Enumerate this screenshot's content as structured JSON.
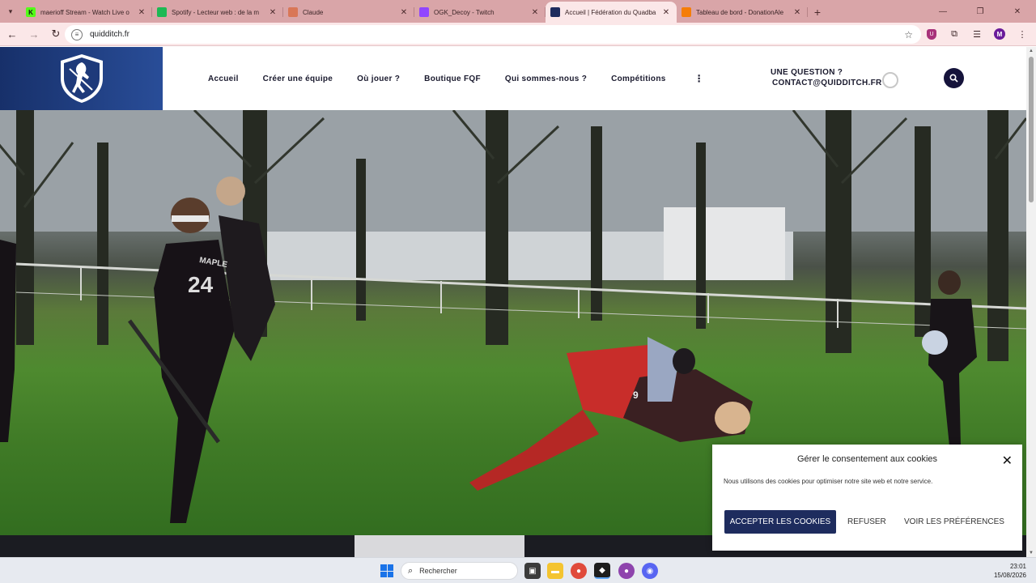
{
  "browser": {
    "tabs": [
      {
        "title": "maerioff Stream - Watch Live o",
        "favicon_color": "#53fc18",
        "favicon_letter": "K",
        "active": false
      },
      {
        "title": "Spotify - Lecteur web : de la m",
        "favicon_color": "#1db954",
        "favicon_letter": "",
        "active": false
      },
      {
        "title": "Claude",
        "favicon_color": "#d97757",
        "favicon_letter": "",
        "active": false
      },
      {
        "title": "OGK_Decoy - Twitch",
        "favicon_color": "#9146ff",
        "favicon_letter": "",
        "active": false
      },
      {
        "title": "Accueil | Fédération du Quadba",
        "favicon_color": "#1e2c5e",
        "favicon_letter": "",
        "active": true
      },
      {
        "title": "Tableau de bord - DonationAle",
        "favicon_color": "#f57d07",
        "favicon_letter": "",
        "active": false
      }
    ],
    "url": "quidditch.fr",
    "profile_initial": "M"
  },
  "site": {
    "nav": [
      {
        "label": "Accueil"
      },
      {
        "label": "Créer une équipe"
      },
      {
        "label": "Où jouer ?"
      },
      {
        "label": "Boutique FQF"
      },
      {
        "label": "Qui sommes-nous ?"
      },
      {
        "label": "Compétitions"
      }
    ],
    "contact_question": "UNE QUESTION ?",
    "contact_email": "CONTACT@QUIDDITCH.FR",
    "accent": "#15133b",
    "logo_color": "#1e3a7a"
  },
  "hero": {
    "jersey_number_1": "24",
    "jersey_name_1": "MAPLE",
    "jersey_number_2": "9"
  },
  "cookie": {
    "title": "Gérer le consentement aux cookies",
    "text": "Nous utilisons des cookies pour optimiser notre site web et notre service.",
    "accept": "ACCEPTER LES COOKIES",
    "refuse": "REFUSER",
    "prefs": "VOIR LES PRÉFÉRENCES"
  },
  "taskbar": {
    "search_placeholder": "Rechercher",
    "time": "23:01",
    "date": "15/08/2026"
  }
}
